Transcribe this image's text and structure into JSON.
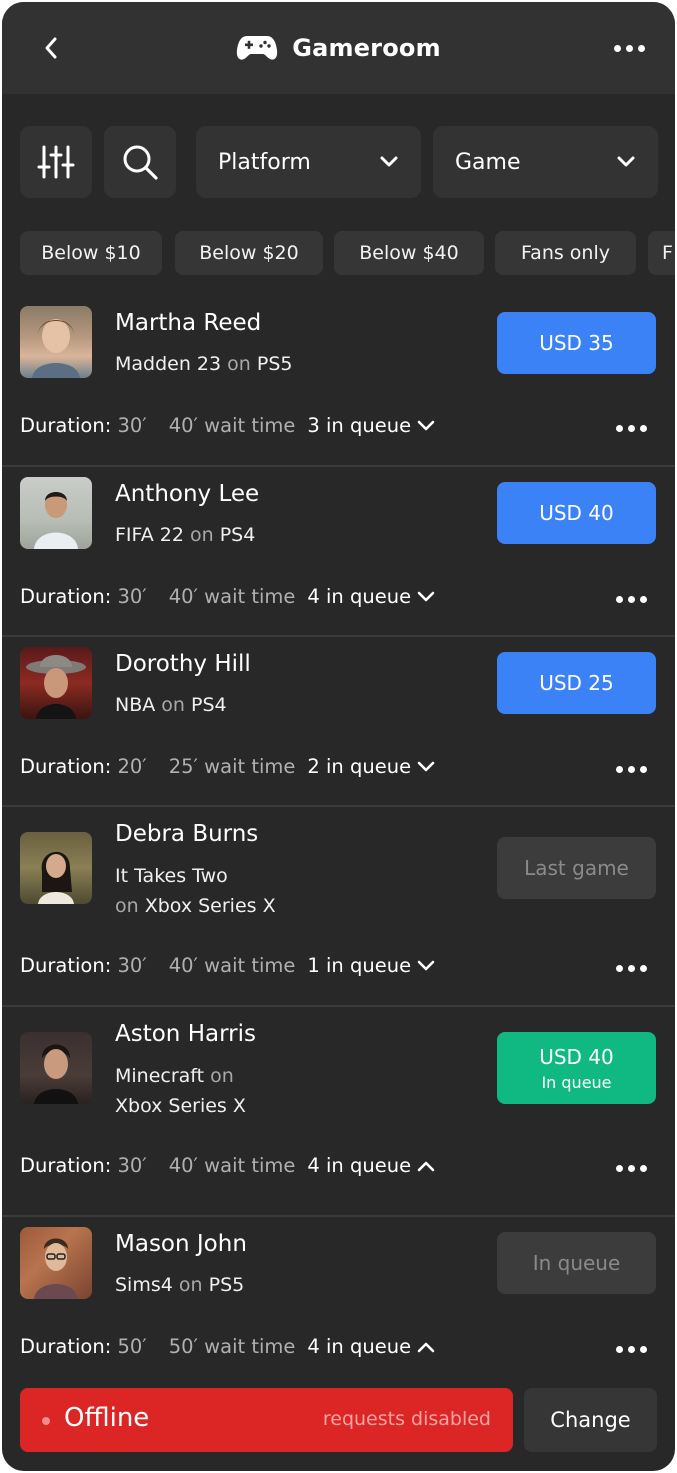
{
  "header": {
    "title": "Gameroom",
    "back_icon": "chevron-left-icon",
    "logo_icon": "gamepad-icon",
    "more_icon": "more-horizontal-icon"
  },
  "filters": {
    "settings_icon": "sliders-icon",
    "search_icon": "search-icon",
    "platform_label": "Platform",
    "game_label": "Game"
  },
  "chips": [
    "Below $10",
    "Below $20",
    "Below $40",
    "Fans only",
    "F"
  ],
  "labels": {
    "duration": "Duration:",
    "wait_suffix": "wait time",
    "on": "on"
  },
  "players": [
    {
      "name": "Martha Reed",
      "game": "Madden 23",
      "platform": "PS5",
      "price": "USD 35",
      "price_sub": "",
      "price_style": "blue",
      "duration": "30′",
      "wait": "40′",
      "queue": "3 in queue",
      "expanded": false
    },
    {
      "name": "Anthony Lee",
      "game": "FIFA 22",
      "platform": "PS4",
      "price": "USD 40",
      "price_sub": "",
      "price_style": "blue",
      "duration": "30′",
      "wait": "40′",
      "queue": "4 in queue",
      "expanded": false
    },
    {
      "name": "Dorothy Hill",
      "game": "NBA",
      "platform": "PS4",
      "price": "USD 25",
      "price_sub": "",
      "price_style": "blue",
      "duration": "20′",
      "wait": "25′",
      "queue": "2 in queue",
      "expanded": false
    },
    {
      "name": "Debra Burns",
      "game": "It Takes Two",
      "platform": "Xbox Series X",
      "price": "Last game",
      "price_sub": "",
      "price_style": "gray",
      "duration": "30′",
      "wait": "40′",
      "queue": "1 in queue",
      "expanded": false
    },
    {
      "name": "Aston Harris",
      "game": "Minecraft",
      "platform": "Xbox Series X",
      "price": "USD 40",
      "price_sub": "In queue",
      "price_style": "green",
      "duration": "30′",
      "wait": "40′",
      "queue": "4 in queue",
      "expanded": true
    },
    {
      "name": "Mason John",
      "game": "Sims4",
      "platform": "PS5",
      "price": "In queue",
      "price_sub": "",
      "price_style": "gray",
      "duration": "50′",
      "wait": "50′",
      "queue": "4 in queue",
      "expanded": true
    }
  ],
  "status_bar": {
    "state": "Offline",
    "note": "requests disabled",
    "change_label": "Change"
  },
  "colors": {
    "background": "#282828",
    "header": "#323232",
    "accent_blue": "#3b82f6",
    "accent_green": "#10b981",
    "offline_red": "#dc2626"
  }
}
